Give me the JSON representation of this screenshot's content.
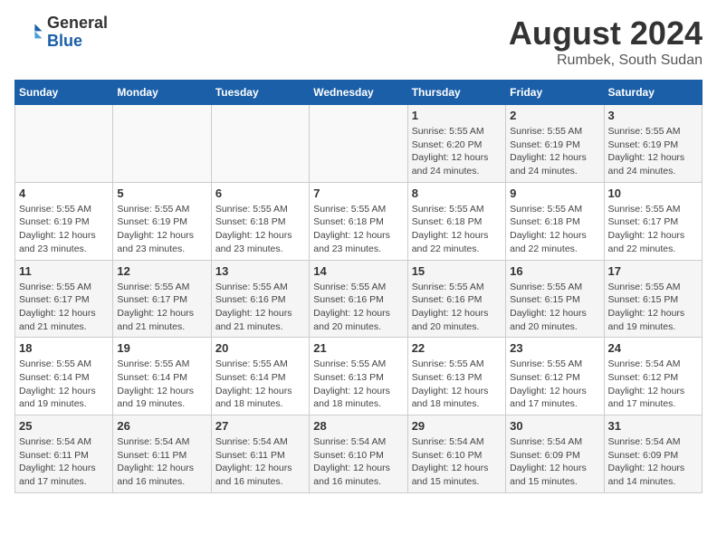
{
  "header": {
    "logo_general": "General",
    "logo_blue": "Blue",
    "month_year": "August 2024",
    "location": "Rumbek, South Sudan"
  },
  "weekdays": [
    "Sunday",
    "Monday",
    "Tuesday",
    "Wednesday",
    "Thursday",
    "Friday",
    "Saturday"
  ],
  "weeks": [
    [
      {
        "day": "",
        "detail": ""
      },
      {
        "day": "",
        "detail": ""
      },
      {
        "day": "",
        "detail": ""
      },
      {
        "day": "",
        "detail": ""
      },
      {
        "day": "1",
        "detail": "Sunrise: 5:55 AM\nSunset: 6:20 PM\nDaylight: 12 hours\nand 24 minutes."
      },
      {
        "day": "2",
        "detail": "Sunrise: 5:55 AM\nSunset: 6:19 PM\nDaylight: 12 hours\nand 24 minutes."
      },
      {
        "day": "3",
        "detail": "Sunrise: 5:55 AM\nSunset: 6:19 PM\nDaylight: 12 hours\nand 24 minutes."
      }
    ],
    [
      {
        "day": "4",
        "detail": "Sunrise: 5:55 AM\nSunset: 6:19 PM\nDaylight: 12 hours\nand 23 minutes."
      },
      {
        "day": "5",
        "detail": "Sunrise: 5:55 AM\nSunset: 6:19 PM\nDaylight: 12 hours\nand 23 minutes."
      },
      {
        "day": "6",
        "detail": "Sunrise: 5:55 AM\nSunset: 6:18 PM\nDaylight: 12 hours\nand 23 minutes."
      },
      {
        "day": "7",
        "detail": "Sunrise: 5:55 AM\nSunset: 6:18 PM\nDaylight: 12 hours\nand 23 minutes."
      },
      {
        "day": "8",
        "detail": "Sunrise: 5:55 AM\nSunset: 6:18 PM\nDaylight: 12 hours\nand 22 minutes."
      },
      {
        "day": "9",
        "detail": "Sunrise: 5:55 AM\nSunset: 6:18 PM\nDaylight: 12 hours\nand 22 minutes."
      },
      {
        "day": "10",
        "detail": "Sunrise: 5:55 AM\nSunset: 6:17 PM\nDaylight: 12 hours\nand 22 minutes."
      }
    ],
    [
      {
        "day": "11",
        "detail": "Sunrise: 5:55 AM\nSunset: 6:17 PM\nDaylight: 12 hours\nand 21 minutes."
      },
      {
        "day": "12",
        "detail": "Sunrise: 5:55 AM\nSunset: 6:17 PM\nDaylight: 12 hours\nand 21 minutes."
      },
      {
        "day": "13",
        "detail": "Sunrise: 5:55 AM\nSunset: 6:16 PM\nDaylight: 12 hours\nand 21 minutes."
      },
      {
        "day": "14",
        "detail": "Sunrise: 5:55 AM\nSunset: 6:16 PM\nDaylight: 12 hours\nand 20 minutes."
      },
      {
        "day": "15",
        "detail": "Sunrise: 5:55 AM\nSunset: 6:16 PM\nDaylight: 12 hours\nand 20 minutes."
      },
      {
        "day": "16",
        "detail": "Sunrise: 5:55 AM\nSunset: 6:15 PM\nDaylight: 12 hours\nand 20 minutes."
      },
      {
        "day": "17",
        "detail": "Sunrise: 5:55 AM\nSunset: 6:15 PM\nDaylight: 12 hours\nand 19 minutes."
      }
    ],
    [
      {
        "day": "18",
        "detail": "Sunrise: 5:55 AM\nSunset: 6:14 PM\nDaylight: 12 hours\nand 19 minutes."
      },
      {
        "day": "19",
        "detail": "Sunrise: 5:55 AM\nSunset: 6:14 PM\nDaylight: 12 hours\nand 19 minutes."
      },
      {
        "day": "20",
        "detail": "Sunrise: 5:55 AM\nSunset: 6:14 PM\nDaylight: 12 hours\nand 18 minutes."
      },
      {
        "day": "21",
        "detail": "Sunrise: 5:55 AM\nSunset: 6:13 PM\nDaylight: 12 hours\nand 18 minutes."
      },
      {
        "day": "22",
        "detail": "Sunrise: 5:55 AM\nSunset: 6:13 PM\nDaylight: 12 hours\nand 18 minutes."
      },
      {
        "day": "23",
        "detail": "Sunrise: 5:55 AM\nSunset: 6:12 PM\nDaylight: 12 hours\nand 17 minutes."
      },
      {
        "day": "24",
        "detail": "Sunrise: 5:54 AM\nSunset: 6:12 PM\nDaylight: 12 hours\nand 17 minutes."
      }
    ],
    [
      {
        "day": "25",
        "detail": "Sunrise: 5:54 AM\nSunset: 6:11 PM\nDaylight: 12 hours\nand 17 minutes."
      },
      {
        "day": "26",
        "detail": "Sunrise: 5:54 AM\nSunset: 6:11 PM\nDaylight: 12 hours\nand 16 minutes."
      },
      {
        "day": "27",
        "detail": "Sunrise: 5:54 AM\nSunset: 6:11 PM\nDaylight: 12 hours\nand 16 minutes."
      },
      {
        "day": "28",
        "detail": "Sunrise: 5:54 AM\nSunset: 6:10 PM\nDaylight: 12 hours\nand 16 minutes."
      },
      {
        "day": "29",
        "detail": "Sunrise: 5:54 AM\nSunset: 6:10 PM\nDaylight: 12 hours\nand 15 minutes."
      },
      {
        "day": "30",
        "detail": "Sunrise: 5:54 AM\nSunset: 6:09 PM\nDaylight: 12 hours\nand 15 minutes."
      },
      {
        "day": "31",
        "detail": "Sunrise: 5:54 AM\nSunset: 6:09 PM\nDaylight: 12 hours\nand 14 minutes."
      }
    ]
  ]
}
